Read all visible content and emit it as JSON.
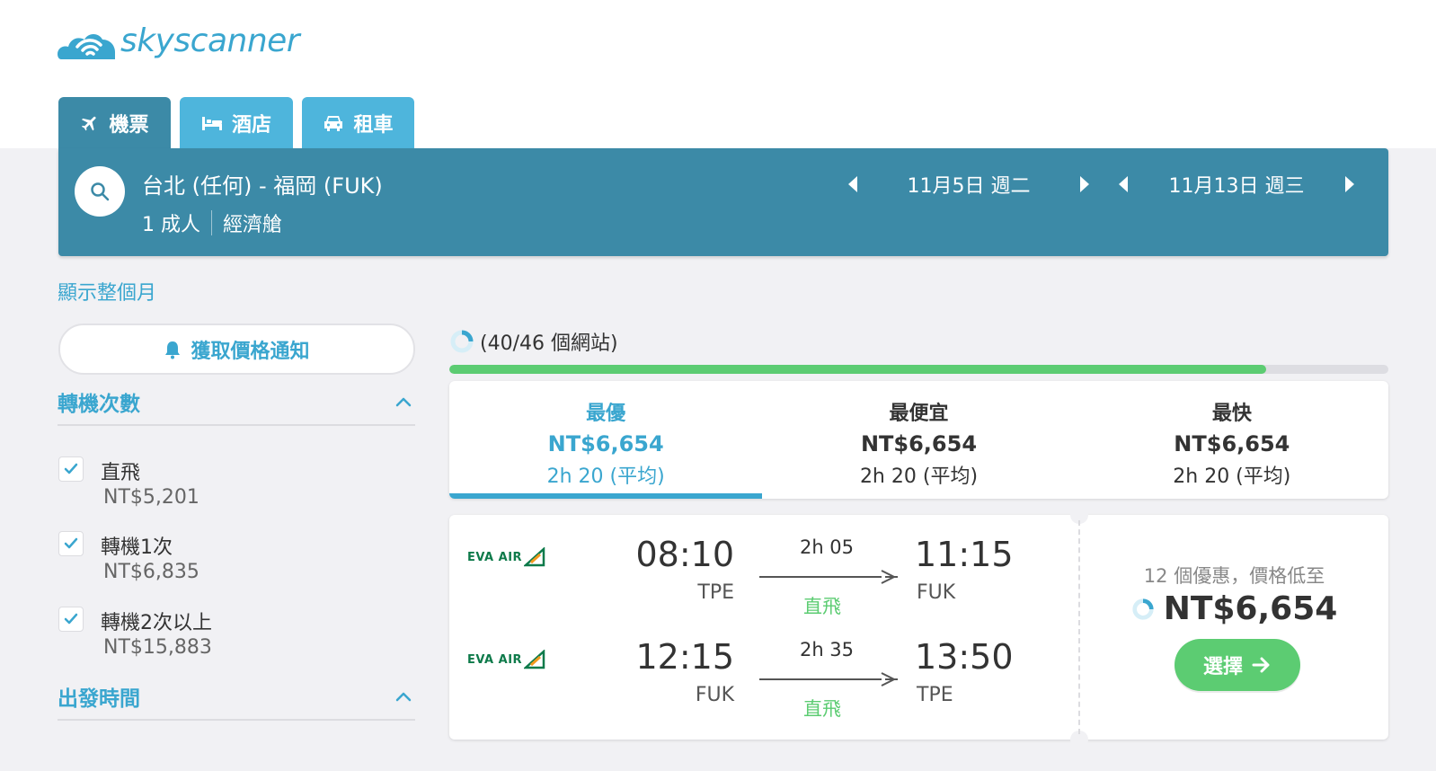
{
  "brand": {
    "name": "skyscanner",
    "color": "#3aa6cf"
  },
  "tabs": [
    {
      "label": "機票",
      "icon": "plane-icon",
      "active": true
    },
    {
      "label": "酒店",
      "icon": "bed-icon",
      "active": false
    },
    {
      "label": "租車",
      "icon": "car-icon",
      "active": false
    }
  ],
  "search": {
    "route": "台北 (任何) - 福岡 (FUK)",
    "passengers": "1 成人",
    "cabin": "經濟艙",
    "depart_date": "11月5日 週二",
    "return_date": "11月13日 週三"
  },
  "sidebar": {
    "month_link": "顯示整個月",
    "price_alert": "獲取價格通知",
    "stops_heading": "轉機次數",
    "stops": [
      {
        "label": "直飛",
        "price": "NT$5,201",
        "checked": true
      },
      {
        "label": "轉機1次",
        "price": "NT$6,835",
        "checked": true
      },
      {
        "label": "轉機2次以上",
        "price": "NT$15,883",
        "checked": true
      }
    ],
    "departure_heading": "出發時間"
  },
  "progress": {
    "text": "(40/46 個網站)",
    "fraction": 0.87,
    "color": "#5ccc72"
  },
  "sort_tabs": [
    {
      "title": "最優",
      "price": "NT$6,654",
      "duration": "2h 20 (平均)",
      "active": true
    },
    {
      "title": "最便宜",
      "price": "NT$6,654",
      "duration": "2h 20 (平均)",
      "active": false
    },
    {
      "title": "最快",
      "price": "NT$6,654",
      "duration": "2h 20 (平均)",
      "active": false
    }
  ],
  "result": {
    "legs": [
      {
        "airline": "EVA AIR",
        "depart_time": "08:10",
        "depart_code": "TPE",
        "duration": "2h 05",
        "stops": "直飛",
        "arrive_time": "11:15",
        "arrive_code": "FUK"
      },
      {
        "airline": "EVA AIR",
        "depart_time": "12:15",
        "depart_code": "FUK",
        "duration": "2h 35",
        "stops": "直飛",
        "arrive_time": "13:50",
        "arrive_code": "TPE"
      }
    ],
    "deals_text": "12 個優惠，價格低至",
    "price": "NT$6,654",
    "select_label": "選擇"
  }
}
